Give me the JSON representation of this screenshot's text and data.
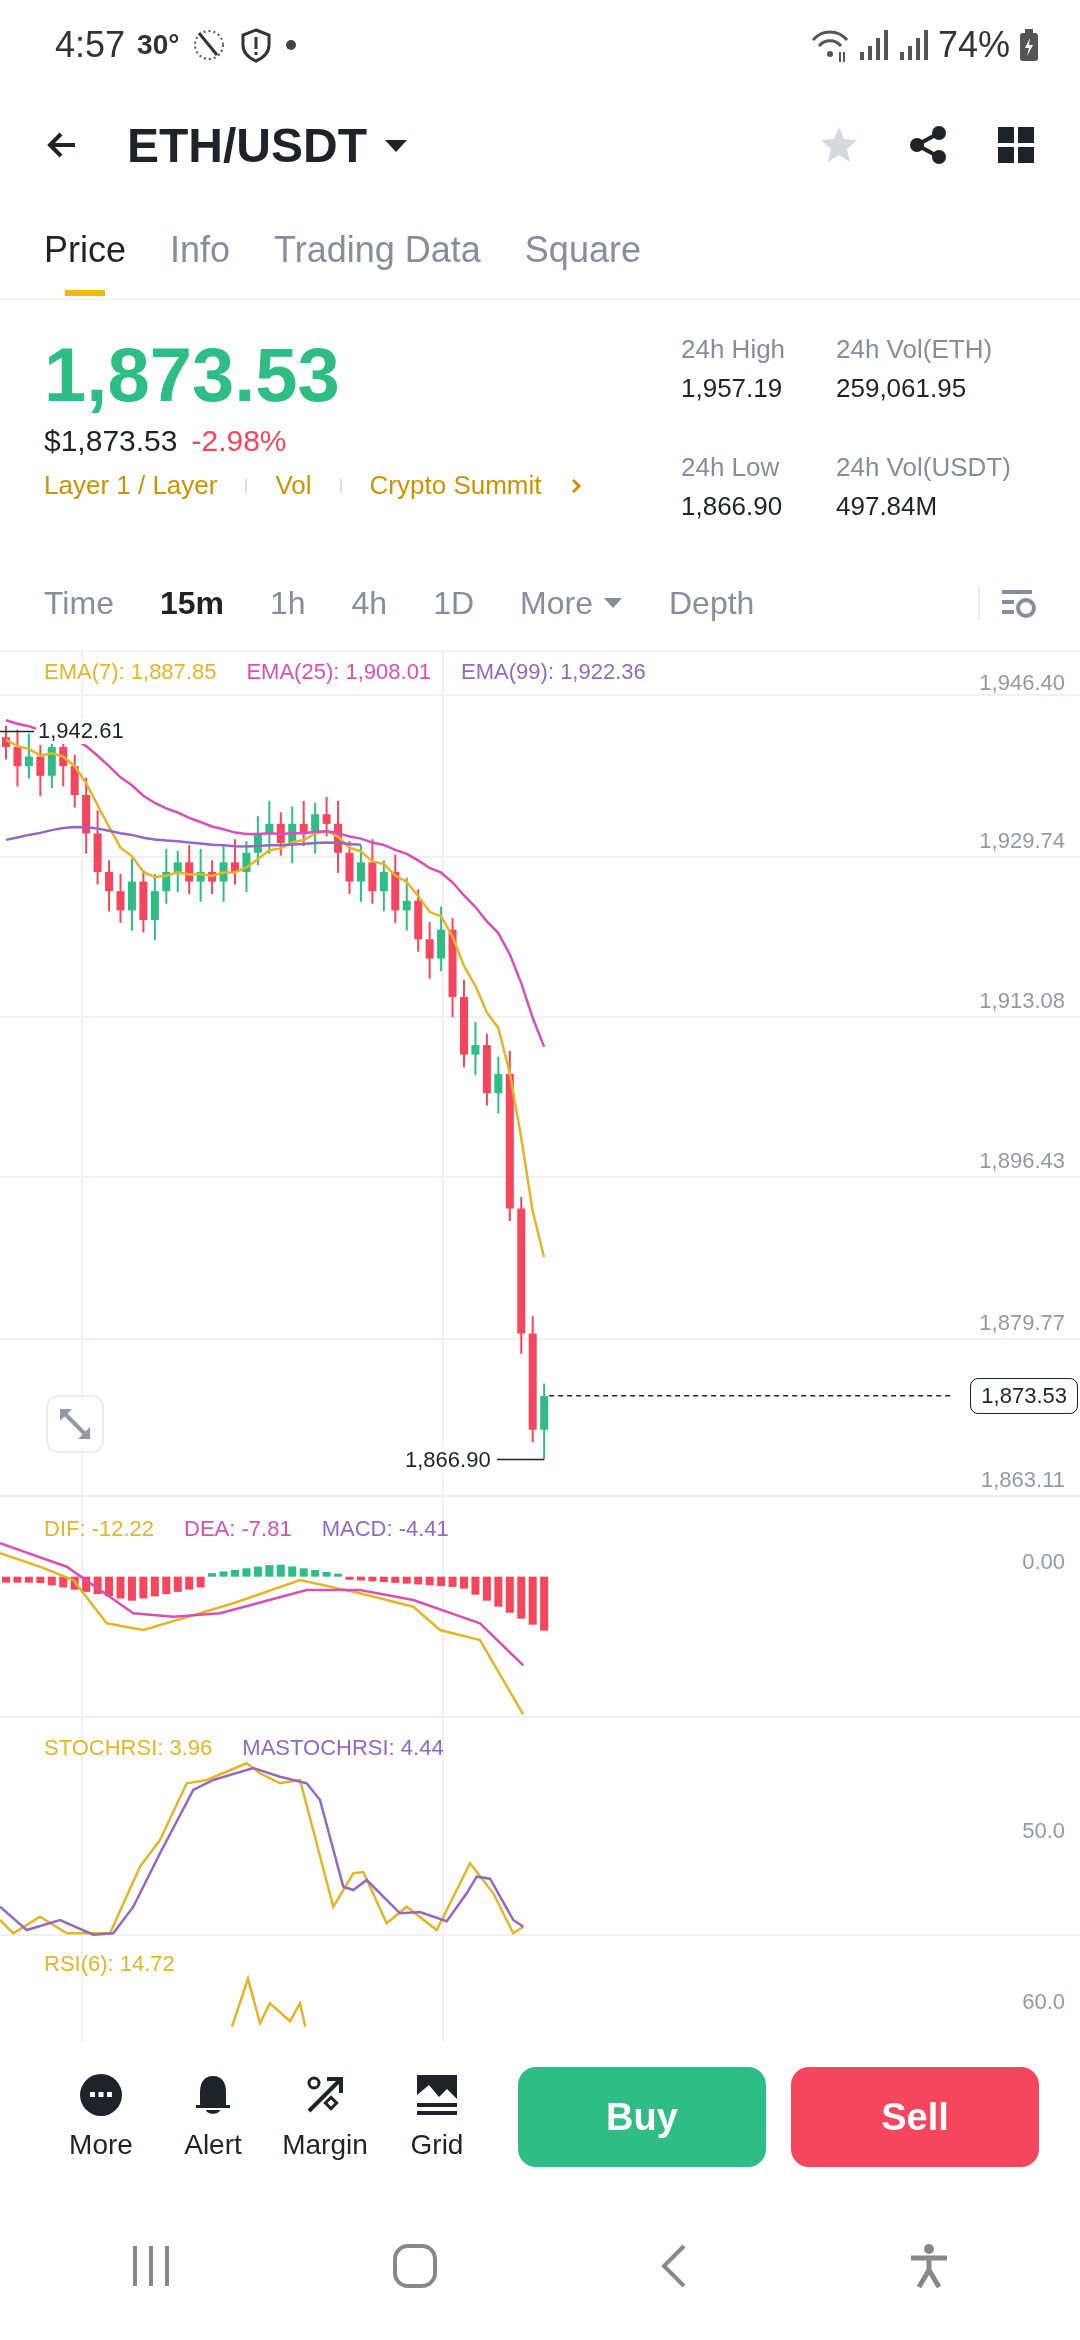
{
  "status_bar": {
    "time": "4:57",
    "temperature": "30°",
    "battery": "74%"
  },
  "header": {
    "pair": "ETH/USDT",
    "favorite": false
  },
  "tabs": [
    {
      "label": "Price",
      "selected": true
    },
    {
      "label": "Info",
      "selected": false
    },
    {
      "label": "Trading Data",
      "selected": false
    },
    {
      "label": "Square",
      "selected": false
    }
  ],
  "price": {
    "last": "1,873.53",
    "usd": "$1,873.53",
    "change": "-2.98%",
    "tags": [
      "Layer 1 / Layer",
      "Vol",
      "Crypto Summit"
    ]
  },
  "stats": [
    {
      "label": "24h High",
      "value": "1,957.19"
    },
    {
      "label": "24h Vol(ETH)",
      "value": "259,061.95"
    },
    {
      "label": "24h Low",
      "value": "1,866.90"
    },
    {
      "label": "24h Vol(USDT)",
      "value": "497.84M"
    }
  ],
  "timeframes": [
    {
      "label": "Time",
      "kind": "option",
      "selected": false
    },
    {
      "label": "15m",
      "kind": "option",
      "selected": true
    },
    {
      "label": "1h",
      "kind": "option",
      "selected": false
    },
    {
      "label": "4h",
      "kind": "option",
      "selected": false
    },
    {
      "label": "1D",
      "kind": "option",
      "selected": false
    },
    {
      "label": "More",
      "kind": "dropdown",
      "selected": false
    },
    {
      "label": "Depth",
      "kind": "option",
      "selected": false
    }
  ],
  "chart": {
    "legend": [
      {
        "text": "EMA(7): 1,887.85",
        "color": "#e3b527"
      },
      {
        "text": "EMA(25): 1,908.01",
        "color": "#d750b4"
      },
      {
        "text": "EMA(99): 1,922.36",
        "color": "#9368c0"
      }
    ],
    "y_axis": [
      "1,946.40",
      "1,929.74",
      "1,913.08",
      "1,896.43",
      "1,879.77",
      "1,863.11"
    ],
    "high_marker": "1,942.61",
    "low_marker": "1,866.90",
    "current_price": "1,873.53"
  },
  "macd": {
    "legend": [
      {
        "text": "DIF: -12.22",
        "color": "#e3b527"
      },
      {
        "text": "DEA: -7.81",
        "color": "#d750b4"
      },
      {
        "text": "MACD: -4.41",
        "color": "#9368c0"
      }
    ],
    "axis": "0.00"
  },
  "stochrsi": {
    "legend": [
      {
        "text": "STOCHRSI: 3.96",
        "color": "#e3b527"
      },
      {
        "text": "MASTOCHRSI: 4.44",
        "color": "#9368c0"
      }
    ],
    "axis": "50.0"
  },
  "rsi": {
    "legend": [
      {
        "text": "RSI(6): 14.72",
        "color": "#e3b527"
      }
    ],
    "axis": "60.0"
  },
  "actions": [
    {
      "label": "More",
      "kind": "more"
    },
    {
      "label": "Alert",
      "kind": "alert"
    },
    {
      "label": "Margin",
      "kind": "margin"
    },
    {
      "label": "Grid",
      "kind": "grid"
    }
  ],
  "trade_buttons": [
    {
      "label": "Buy",
      "kind": "buy"
    },
    {
      "label": "Sell",
      "kind": "sell"
    }
  ]
}
